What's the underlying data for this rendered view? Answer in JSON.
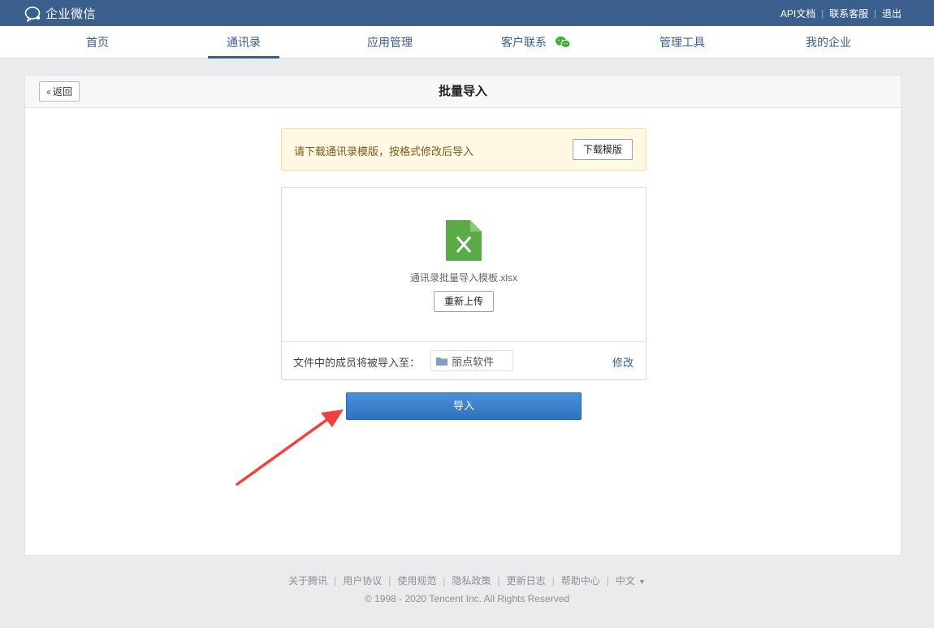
{
  "app": {
    "name": "企业微信"
  },
  "top_links": [
    "API文档",
    "联系客服",
    "退出"
  ],
  "nav": {
    "items": [
      {
        "label": "首页",
        "active": false
      },
      {
        "label": "通讯录",
        "active": true
      },
      {
        "label": "应用管理",
        "active": false
      },
      {
        "label": "客户联系",
        "active": false
      },
      {
        "label": "管理工具",
        "active": false
      },
      {
        "label": "我的企业",
        "active": false
      }
    ]
  },
  "page": {
    "back_label": "返回",
    "title": "批量导入"
  },
  "notice": {
    "text": "请下载通讯录模版，按格式修改后导入",
    "download_label": "下载模版"
  },
  "upload": {
    "file_icon_letter": "X",
    "file_name": "通讯录批量导入模板.xlsx",
    "reupload_label": "重新上传",
    "dest_label": "文件中的成员将被导入至：",
    "dest_department": "丽点软件",
    "modify_label": "修改"
  },
  "import_label": "导入",
  "footer": {
    "links": [
      "关于腾讯",
      "用户协议",
      "使用规范",
      "隐私政策",
      "更新日志",
      "帮助中心",
      "中文"
    ],
    "copyright": "© 1998 - 2020 Tencent Inc. All Rights Reserved"
  },
  "colors": {
    "topbar": "#3a5f8c",
    "primary_button": "#3178c6",
    "excel_green": "#5aab47",
    "annotation_arrow": "#f2403a"
  }
}
